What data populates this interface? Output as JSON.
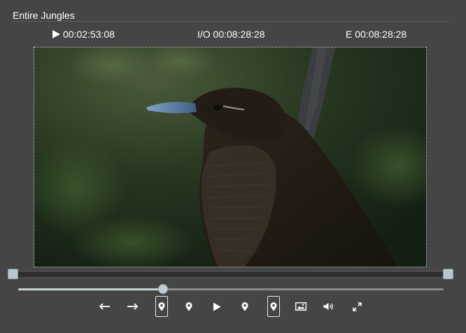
{
  "panel": {
    "title": "Entire Jungles"
  },
  "timecodes": {
    "current": "00:02:53:08",
    "in_out": "I/O 00:08:28:28",
    "end": "E 00:08:28:28"
  },
  "player": {
    "scrub_progress": 0.34
  },
  "controls": [
    {
      "name": "step-back-button",
      "icon": "arrow-left-icon",
      "boxed": false
    },
    {
      "name": "step-forward-button",
      "icon": "arrow-right-icon",
      "boxed": false
    },
    {
      "name": "mark-in-button",
      "icon": "map-pin-icon",
      "boxed": true
    },
    {
      "name": "go-to-in-button",
      "icon": "map-pin-icon",
      "boxed": false
    },
    {
      "name": "play-button",
      "icon": "play-icon",
      "boxed": false
    },
    {
      "name": "go-to-out-button",
      "icon": "map-pin-icon",
      "boxed": false
    },
    {
      "name": "mark-out-button",
      "icon": "map-pin-icon",
      "boxed": true
    },
    {
      "name": "snapshot-button",
      "icon": "image-icon",
      "boxed": false
    },
    {
      "name": "volume-button",
      "icon": "speaker-icon",
      "boxed": false
    },
    {
      "name": "fullscreen-button",
      "icon": "expand-icon",
      "boxed": false
    }
  ],
  "colors": {
    "background": "#454545",
    "text": "#ffffff",
    "handle": "#b8c6cc"
  }
}
